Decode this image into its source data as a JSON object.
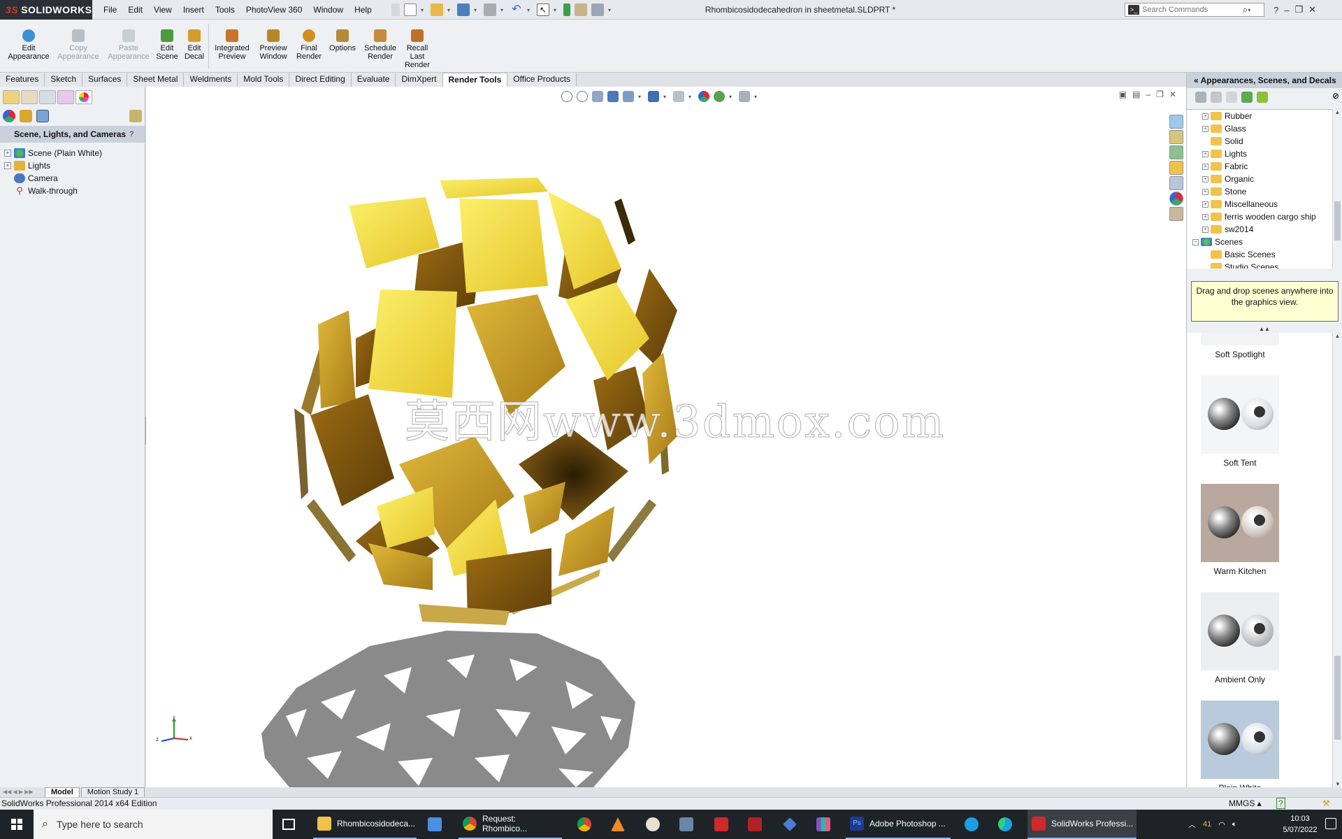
{
  "app": {
    "logo_text": "SOLIDWORKS",
    "logo_prefix": "3S",
    "menus": [
      "File",
      "Edit",
      "View",
      "Insert",
      "Tools",
      "PhotoView 360",
      "Window",
      "Help"
    ],
    "document_title": "Rhombicosidodecahedron in sheetmetal.SLDPRT *",
    "search_placeholder": "Search Commands"
  },
  "ribbon": {
    "buttons": [
      {
        "label_1": "Edit",
        "label_2": "Appearance",
        "label_3": "",
        "enabled": true,
        "color": "#3b8fd6"
      },
      {
        "label_1": "Copy",
        "label_2": "Appearance",
        "label_3": "",
        "enabled": false,
        "color": "#b9bec4"
      },
      {
        "label_1": "Paste",
        "label_2": "Appearance",
        "label_3": "",
        "enabled": false,
        "color": "#c9ced3"
      },
      {
        "label_1": "Edit",
        "label_2": "Scene",
        "label_3": "",
        "enabled": true,
        "color": "#4e9a3e"
      },
      {
        "label_1": "Edit",
        "label_2": "Decal",
        "label_3": "",
        "enabled": true,
        "color": "#d79b2b"
      },
      {
        "label_1": "Integrated",
        "label_2": "Preview",
        "label_3": "",
        "enabled": true,
        "color": "#c8742a"
      },
      {
        "label_1": "Preview",
        "label_2": "Window",
        "label_3": "",
        "enabled": true,
        "color": "#b8862a"
      },
      {
        "label_1": "Final",
        "label_2": "Render",
        "label_3": "",
        "enabled": true,
        "color": "#d0901f"
      },
      {
        "label_1": "Options",
        "label_2": "",
        "label_3": "",
        "enabled": true,
        "color": "#b38b3a"
      },
      {
        "label_1": "Schedule",
        "label_2": "Render",
        "label_3": "",
        "enabled": true,
        "color": "#c58a3a"
      },
      {
        "label_1": "Recall",
        "label_2": "Last",
        "label_3": "Render",
        "enabled": true,
        "color": "#c0702a"
      }
    ]
  },
  "command_tabs": [
    "Features",
    "Sketch",
    "Surfaces",
    "Sheet Metal",
    "Weldments",
    "Mold Tools",
    "Direct Editing",
    "Evaluate",
    "DimXpert",
    "Render Tools",
    "Office Products"
  ],
  "active_command_tab": "Render Tools",
  "left_panel": {
    "header": "Scene, Lights, and Cameras",
    "tree": [
      {
        "label": "Scene (Plain White)",
        "expandable": true,
        "icon": "scene-icon",
        "color": "#3a7bd5"
      },
      {
        "label": "Lights",
        "expandable": true,
        "icon": "lights-icon",
        "color": "#e2b43a"
      },
      {
        "label": "Camera",
        "expandable": false,
        "icon": "camera-icon",
        "color": "#4a78b8"
      },
      {
        "label": "Walk-through",
        "expandable": false,
        "icon": "walkthrough-icon",
        "color": "#c23030"
      }
    ]
  },
  "viewport": {
    "watermark": "莫西网www.3dmox.com",
    "triad_labels": {
      "x": "x",
      "y": "y",
      "z": "z"
    }
  },
  "task_pane": {
    "header": "Appearances, Scenes, and Decals",
    "tree": [
      {
        "label": "Rubber",
        "expandable": true,
        "indent": 1
      },
      {
        "label": "Glass",
        "expandable": true,
        "indent": 1
      },
      {
        "label": "Solid",
        "expandable": false,
        "indent": 1
      },
      {
        "label": "Lights",
        "expandable": true,
        "indent": 1
      },
      {
        "label": "Fabric",
        "expandable": true,
        "indent": 1
      },
      {
        "label": "Organic",
        "expandable": true,
        "indent": 1
      },
      {
        "label": "Stone",
        "expandable": true,
        "indent": 1
      },
      {
        "label": "Miscellaneous",
        "expandable": true,
        "indent": 1
      },
      {
        "label": "ferris wooden cargo ship",
        "expandable": true,
        "indent": 1
      },
      {
        "label": "sw2014",
        "expandable": true,
        "indent": 1
      },
      {
        "label": "Scenes",
        "expandable": true,
        "indent": 0
      },
      {
        "label": "Basic Scenes",
        "expandable": false,
        "indent": 1
      },
      {
        "label": "Studio Scenes",
        "expandable": false,
        "indent": 1
      }
    ],
    "tip": "Drag and drop scenes anywhere into the graphics view.",
    "scenes": [
      {
        "label": "Soft Spotlight",
        "bg": "#f2f3f5",
        "ball": "#e6e8eb",
        "partial": true
      },
      {
        "label": "Soft Tent",
        "bg": "#f4f5f6",
        "ball": "#dadcdf"
      },
      {
        "label": "Warm Kitchen",
        "bg": "#b9a89e",
        "ball": "#cfc6bf"
      },
      {
        "label": "Ambient Only",
        "bg": "#eceeef",
        "ball": "#bfc2c4"
      },
      {
        "label": "Plain White",
        "bg": "#b8cadb",
        "ball": "#d5dde4"
      }
    ]
  },
  "bottom_tabs": [
    "Model",
    "Motion Study 1"
  ],
  "active_bottom_tab": "Model",
  "status": {
    "edition": "SolidWorks Professional 2014 x64 Edition",
    "units": "MMGS"
  },
  "taskbar": {
    "search_placeholder": "Type here to search",
    "apps": [
      {
        "label": "Rhombicosidodeca...",
        "color": "#f0c24a"
      },
      {
        "label": "Request: Rhombico...",
        "color": "#db4437"
      },
      {
        "label": "Adobe Photoshop ...",
        "color": "#1f3a93"
      },
      {
        "label": "SolidWorks Professi...",
        "color": "#d0282b"
      }
    ],
    "tray_temp": "41",
    "time": "10:03",
    "date": "5/07/2022"
  },
  "colors": {
    "gold_light": "#f4e24a",
    "gold_mid": "#d6a820",
    "gold_dark": "#7a5410",
    "shadow": "#8a8a8a"
  }
}
